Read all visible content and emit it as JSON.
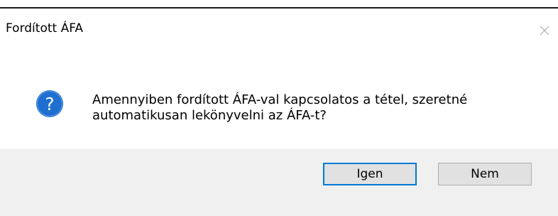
{
  "dialog": {
    "title": "Fordított ÁFA",
    "close_icon": "close-icon",
    "icon": "question-icon",
    "message": "Amennyiben fordított ÁFA-val kapcsolatos a tétel, szeretné automatikusan lekönyvelni az ÁFA-t?",
    "buttons": {
      "yes_label": "Igen",
      "no_label": "Nem"
    }
  },
  "colors": {
    "accent": "#0078d7",
    "icon_blue": "#1e6fd0",
    "button_bar": "#f0f0f0"
  }
}
